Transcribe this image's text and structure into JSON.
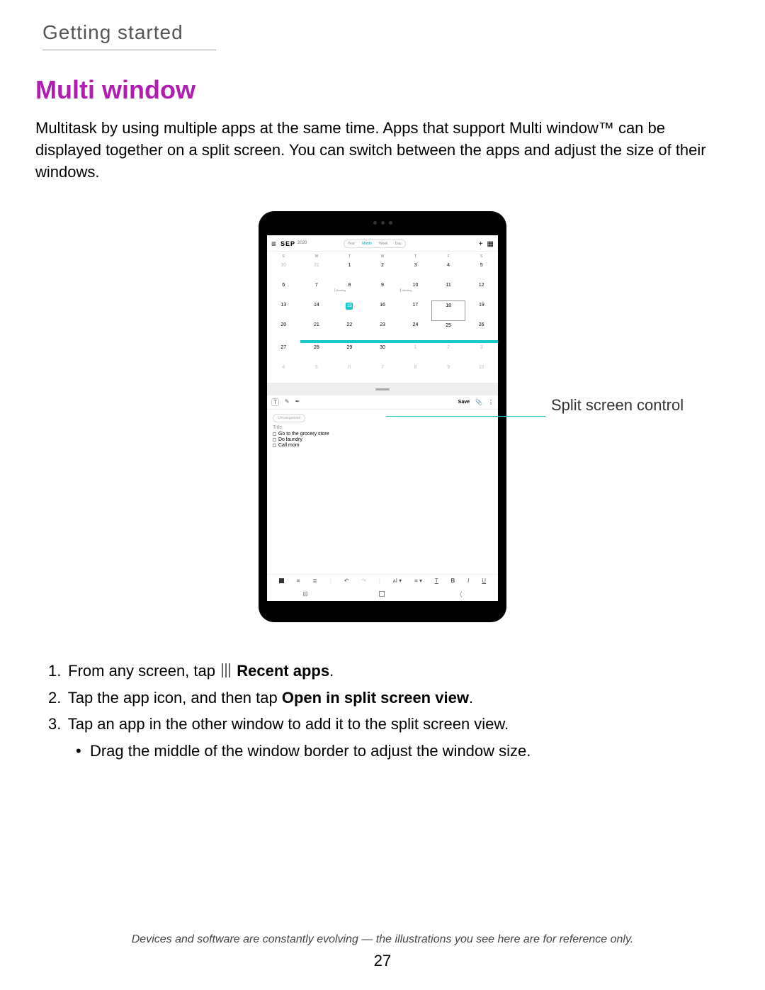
{
  "section_header": "Getting started",
  "title": "Multi window",
  "intro": "Multitask by using multiple apps at the same time. Apps that support Multi window™ can be displayed together on a split screen. You can switch between the apps and adjust the size of their windows.",
  "figure": {
    "callout": "Split screen control",
    "calendar": {
      "month": "SEP",
      "year": "2020",
      "views": [
        "Year",
        "Month",
        "Week",
        "Day"
      ],
      "active_view": "Month",
      "day_abbrev": [
        "S",
        "M",
        "T",
        "W",
        "T",
        "F",
        "S"
      ],
      "rows": [
        [
          {
            "n": "30",
            "dim": true
          },
          {
            "n": "31",
            "dim": true
          },
          {
            "n": "1"
          },
          {
            "n": "2"
          },
          {
            "n": "3"
          },
          {
            "n": "4"
          },
          {
            "n": "5"
          }
        ],
        [
          {
            "n": "6"
          },
          {
            "n": "7"
          },
          {
            "n": "8",
            "evt": "Meeting"
          },
          {
            "n": "9"
          },
          {
            "n": "10",
            "evt": "Meeting"
          },
          {
            "n": "11"
          },
          {
            "n": "12"
          }
        ],
        [
          {
            "n": "13"
          },
          {
            "n": "14"
          },
          {
            "n": "15",
            "today": true
          },
          {
            "n": "16"
          },
          {
            "n": "17"
          },
          {
            "n": "18",
            "box": true
          },
          {
            "n": "19"
          }
        ],
        [
          {
            "n": "20"
          },
          {
            "n": "21"
          },
          {
            "n": "22"
          },
          {
            "n": "23"
          },
          {
            "n": "24"
          },
          {
            "n": "25"
          },
          {
            "n": "26"
          }
        ],
        [
          {
            "n": "27"
          },
          {
            "n": "28"
          },
          {
            "n": "29"
          },
          {
            "n": "30"
          },
          {
            "n": "1",
            "dim": true
          },
          {
            "n": "2",
            "dim": true
          },
          {
            "n": "3",
            "dim": true
          }
        ],
        [
          {
            "n": "4",
            "dim": true
          },
          {
            "n": "5",
            "dim": true
          },
          {
            "n": "6",
            "dim": true
          },
          {
            "n": "7",
            "dim": true
          },
          {
            "n": "8",
            "dim": true
          },
          {
            "n": "9",
            "dim": true
          },
          {
            "n": "10",
            "dim": true
          }
        ]
      ]
    },
    "notes": {
      "chip": "Uncategorized",
      "title_placeholder": "Title",
      "save_label": "Save",
      "items": [
        "Go to the grocery store",
        "Do laundry",
        "Call mom"
      ]
    }
  },
  "steps": {
    "s1_prefix": "From any screen, tap",
    "s1_bold": "Recent apps",
    "s2_prefix": "Tap the app icon, and then tap ",
    "s2_bold": "Open in split screen view",
    "s3": "Tap an app in the other window to add it to the split screen view.",
    "s3_sub": "Drag the middle of the window border to adjust the window size."
  },
  "disclaimer": "Devices and software are constantly evolving — the illustrations you see here are for reference only.",
  "page_number": "27"
}
